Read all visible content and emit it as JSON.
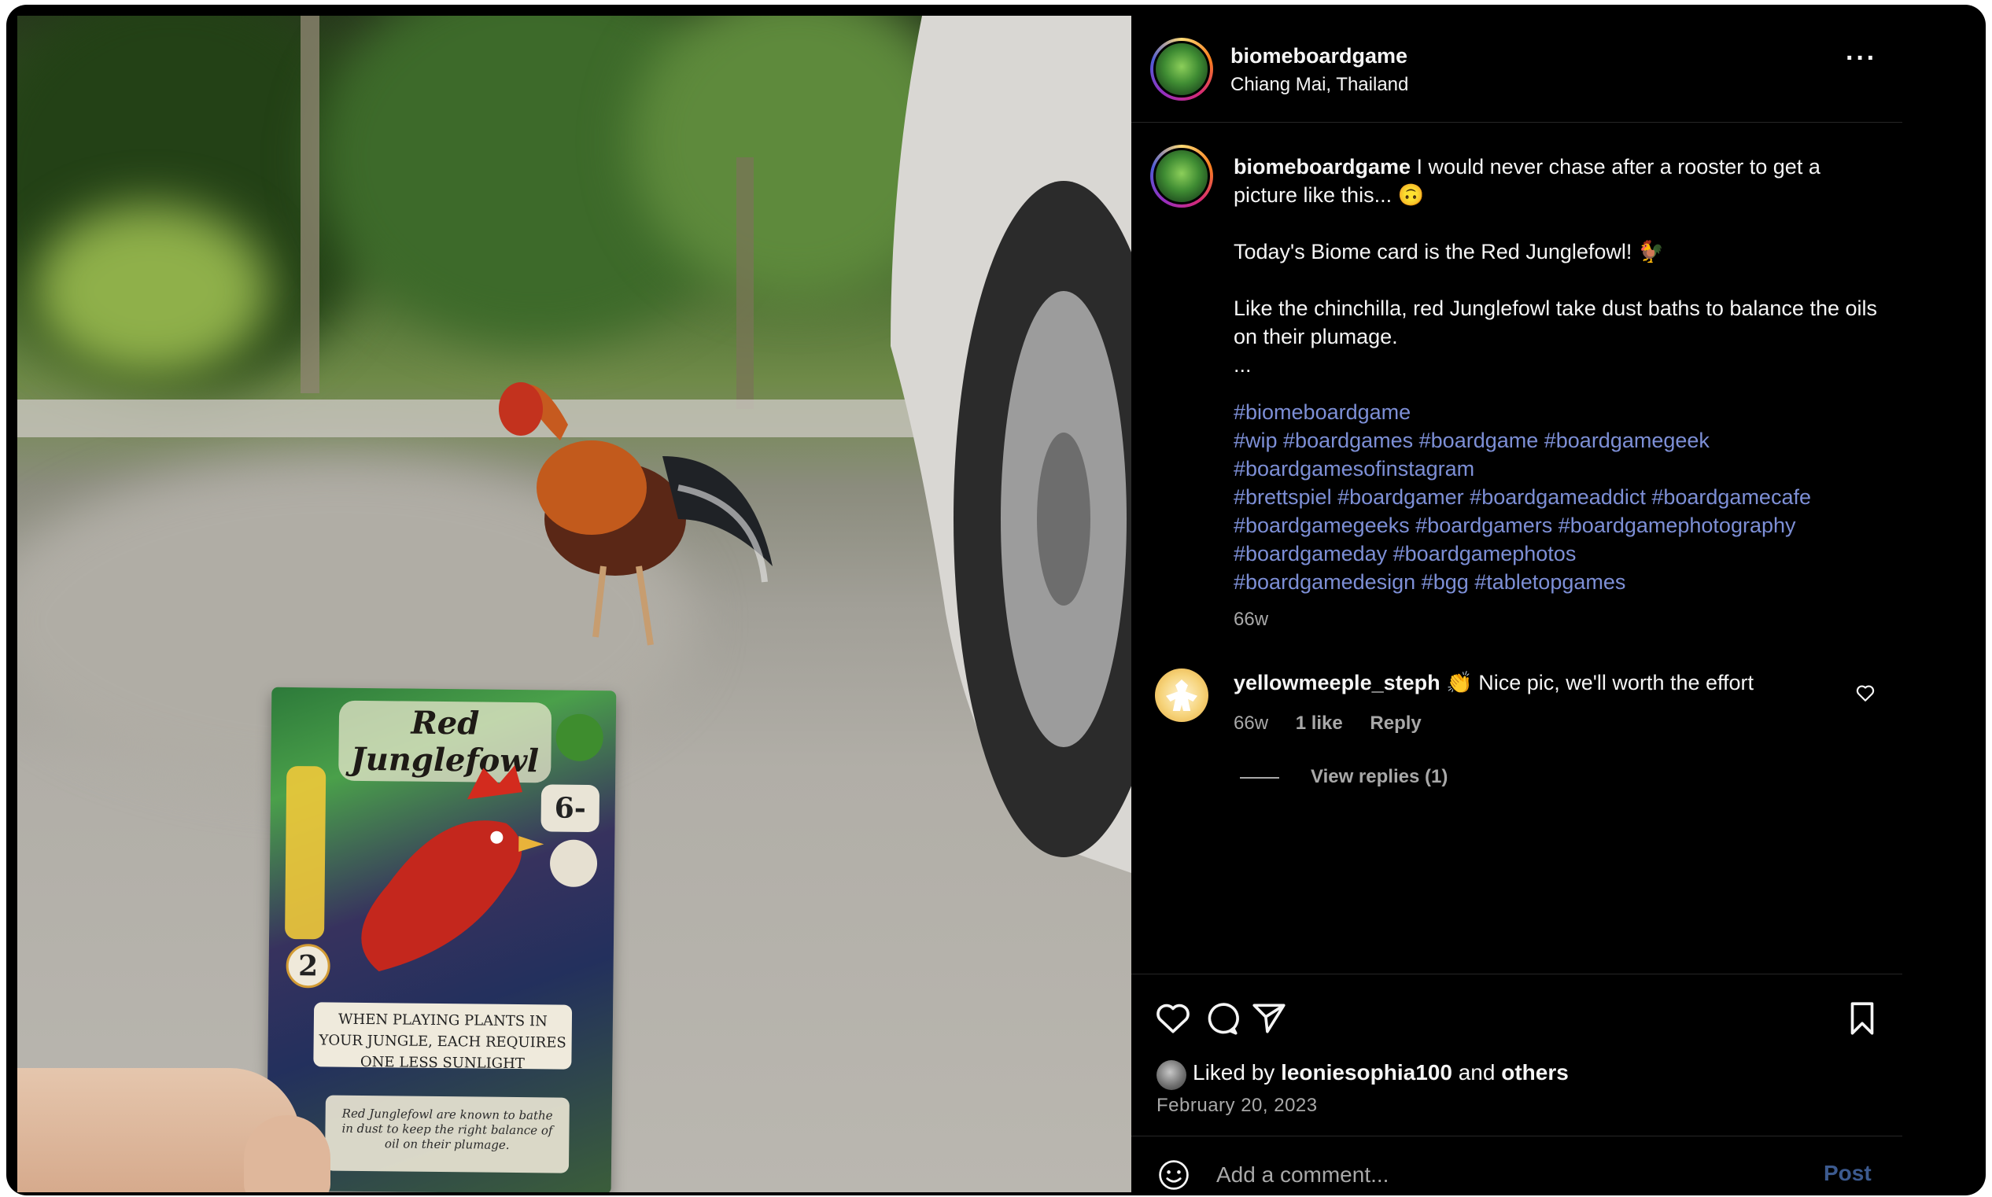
{
  "post": {
    "username": "biomeboardgame",
    "location": "Chiang Mai, Thailand",
    "more_label": "···"
  },
  "card": {
    "title": "Red Junglefowl",
    "stat": "6-",
    "badge": "2",
    "rule": "When playing plants in your jungle, each requires one less sunlight",
    "flavor": "Red Junglefowl are known to bathe in dust to keep the right balance of oil on their plumage."
  },
  "caption": {
    "username": "biomeboardgame",
    "line1": " I would never chase after a rooster to get a picture like this... 🙃",
    "p2": "Today's Biome card is the Red Junglefowl! 🐓",
    "p3": "Like the chinchilla, red Junglefowl take dust baths to balance the oils on their plumage.\n...",
    "tags": [
      "#biomeboardgame",
      "#wip #boardgames #boardgame #boardgamegeek",
      "#boardgamesofinstagram",
      "#brettspiel #boardgamer #boardgameaddict #boardgamecafe",
      "#boardgamegeeks #boardgamers #boardgamephotography",
      "#boardgameday #boardgamephotos",
      "#boardgamedesign #bgg #tabletopgames"
    ],
    "age": "66w"
  },
  "comment": {
    "username": "yellowmeeple_steph",
    "text": " 👏 Nice pic, we'll worth the effort",
    "age": "66w",
    "likes": "1 like",
    "reply": "Reply",
    "view_replies": "View replies (1)"
  },
  "likes": {
    "prefix": "Liked by ",
    "user": "leoniesophia100",
    "middle": " and ",
    "others": "others"
  },
  "date": "February 20, 2023",
  "add_comment": {
    "placeholder": "Add a comment...",
    "post": "Post"
  },
  "colors": {
    "background": "#000000",
    "text": "#f5f5f5",
    "muted": "#a8a8a8",
    "hashtag": "#7d8fd6",
    "post_button": "#3c5a8f"
  }
}
